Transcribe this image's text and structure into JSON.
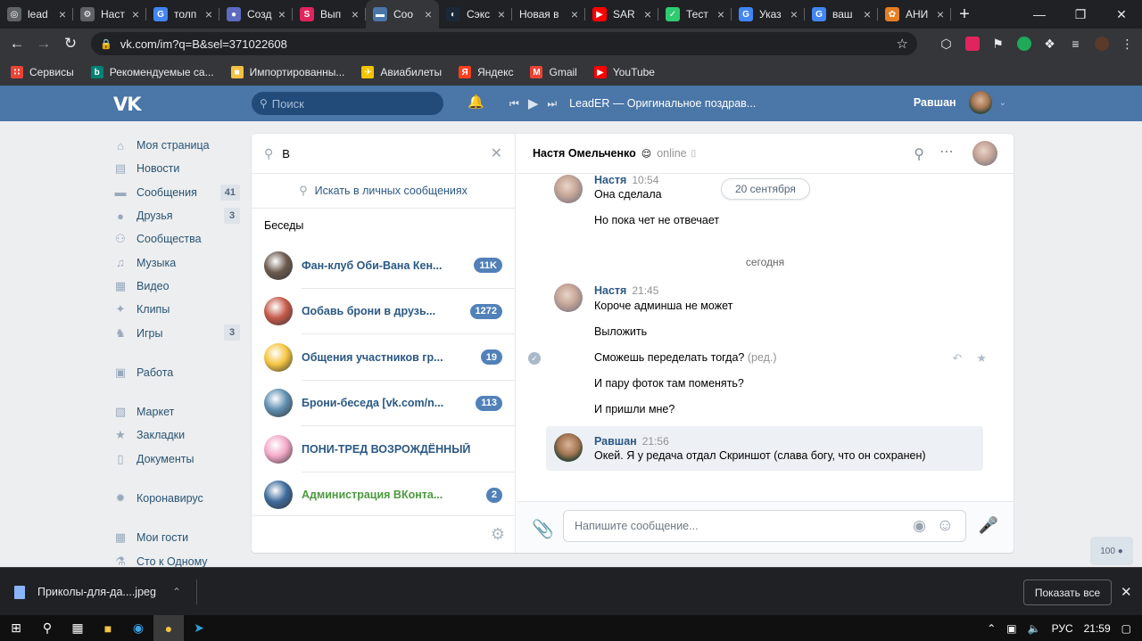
{
  "browser": {
    "tabs": [
      {
        "label": "lead",
        "icon": "globe-icon",
        "color": "#5f6368",
        "active": false
      },
      {
        "label": "Наст",
        "icon": "gear-icon",
        "color": "#5f6368",
        "active": false
      },
      {
        "label": "толп",
        "icon": "google-icon",
        "color": "#4285f4",
        "active": false
      },
      {
        "label": "Созд",
        "icon": "user-icon",
        "color": "#5c6bc0",
        "active": false
      },
      {
        "label": "Вып",
        "icon": "scoop-icon",
        "color": "#e0245e",
        "active": false
      },
      {
        "label": "Соо",
        "icon": "vk-messages-icon",
        "color": "#4a76a8",
        "active": true
      },
      {
        "label": "Сэкс",
        "icon": "steam-icon",
        "color": "#1b2838",
        "active": false
      },
      {
        "label": "Новая в",
        "icon": "",
        "color": "",
        "active": false
      },
      {
        "label": "SAR",
        "icon": "youtube-icon",
        "color": "#ff0000",
        "active": false
      },
      {
        "label": "Тест",
        "icon": "check-icon",
        "color": "#2ecc71",
        "active": false
      },
      {
        "label": "Указ",
        "icon": "google-icon",
        "color": "#4285f4",
        "active": false
      },
      {
        "label": "ваш",
        "icon": "google-icon",
        "color": "#4285f4",
        "active": false
      },
      {
        "label": "АНИ",
        "icon": "flower-icon",
        "color": "#e67e22",
        "active": false
      }
    ],
    "url": "vk.com/im?q=B&sel=371022608",
    "bookmarks": [
      {
        "label": "Сервисы",
        "icon": "apps-grid-icon",
        "color": "#ea4335"
      },
      {
        "label": "Рекомендуемые са...",
        "icon": "bing-icon",
        "color": "#008373"
      },
      {
        "label": "Импортированны...",
        "icon": "folder-icon",
        "color": "#f5c142"
      },
      {
        "label": "Авиабилеты",
        "icon": "plane-icon",
        "color": "#f2c400"
      },
      {
        "label": "Яндекс",
        "icon": "yandex-icon",
        "color": "#fc3f1d"
      },
      {
        "label": "Gmail",
        "icon": "gmail-icon",
        "color": "#ea4335"
      },
      {
        "label": "YouTube",
        "icon": "youtube-icon",
        "color": "#ff0000"
      }
    ]
  },
  "vk": {
    "header": {
      "logo": "VK",
      "search_placeholder": "Поиск",
      "track": "LeadER — Оригинальное поздрав...",
      "user_name": "Равшан"
    },
    "menu": [
      {
        "label": "Моя страница",
        "icon": "home-icon",
        "count": ""
      },
      {
        "label": "Новости",
        "icon": "news-icon",
        "count": ""
      },
      {
        "label": "Сообщения",
        "icon": "messages-icon",
        "count": "41"
      },
      {
        "label": "Друзья",
        "icon": "friends-icon",
        "count": "3"
      },
      {
        "label": "Сообщества",
        "icon": "communities-icon",
        "count": ""
      },
      {
        "label": "Музыка",
        "icon": "music-icon",
        "count": ""
      },
      {
        "label": "Видео",
        "icon": "video-icon",
        "count": ""
      },
      {
        "label": "Клипы",
        "icon": "clips-icon",
        "count": ""
      },
      {
        "label": "Игры",
        "icon": "games-icon",
        "count": "3"
      },
      {
        "label": "Работа",
        "icon": "briefcase-icon",
        "count": "",
        "gap": true
      },
      {
        "label": "Маркет",
        "icon": "market-icon",
        "count": "",
        "gap": true
      },
      {
        "label": "Закладки",
        "icon": "bookmark-star-icon",
        "count": ""
      },
      {
        "label": "Документы",
        "icon": "document-icon",
        "count": ""
      },
      {
        "label": "Коронавирус",
        "icon": "virus-icon",
        "count": "",
        "gap": true
      },
      {
        "label": "Мои гости",
        "icon": "app-icon",
        "count": "",
        "gap": true
      },
      {
        "label": "Сто к Одному",
        "icon": "flask-icon",
        "count": ""
      }
    ],
    "dialogs": {
      "query": "В",
      "search_messages": "Искать в личных сообщениях",
      "section_title": "Беседы",
      "conversations": [
        {
          "name": "Фан-клуб Оби-Вана Кен...",
          "count": "11K",
          "color": "#6b5a4e",
          "green": false
        },
        {
          "name": "Ɑобавь брони в друзь...",
          "count": "1272",
          "color": "#c65a4a",
          "green": false
        },
        {
          "name": "Общения участников гр...",
          "count": "19",
          "color": "#f4c542",
          "green": false
        },
        {
          "name": "Брони-беседа [vk.com/n...",
          "count": "113",
          "color": "#5f8fb0",
          "green": false
        },
        {
          "name": "ПОНИ-ТРЕД ВОЗРОЖДЁННЫЙ",
          "count": "",
          "color": "#f3a8c8",
          "green": false
        },
        {
          "name": "Администрация ВКонта...",
          "count": "2",
          "color": "#3d6b9c",
          "green": true
        }
      ]
    },
    "chat": {
      "peer_name": "Настя Омельченко",
      "peer_status": "online",
      "date_pill": "20 сентября",
      "day_separator": "сегодня",
      "messages": [
        {
          "author": "Настя",
          "time": "10:54",
          "lines": [
            "Она сделала",
            "Но пока чет не отвечает"
          ]
        },
        {
          "author": "Настя",
          "time": "21:45",
          "lines": [
            "Короче админша не может",
            "Выложить",
            "Сможешь переделать тогда?",
            "И пару фоток там поменять?",
            "И пришли мне?"
          ],
          "edited_mark": "(ред.)"
        },
        {
          "author": "Равшан",
          "time": "21:56",
          "lines": [
            "Окей. Я у редача отдал Скриншот (слава богу, что он сохранен)"
          ]
        }
      ],
      "composer_placeholder": "Напишите сообщение..."
    },
    "zoom_badge": "100"
  },
  "downloads": {
    "file": "Приколы-для-да....jpeg",
    "show_all": "Показать все"
  },
  "taskbar": {
    "lang": "РУС",
    "time": "21:59"
  }
}
